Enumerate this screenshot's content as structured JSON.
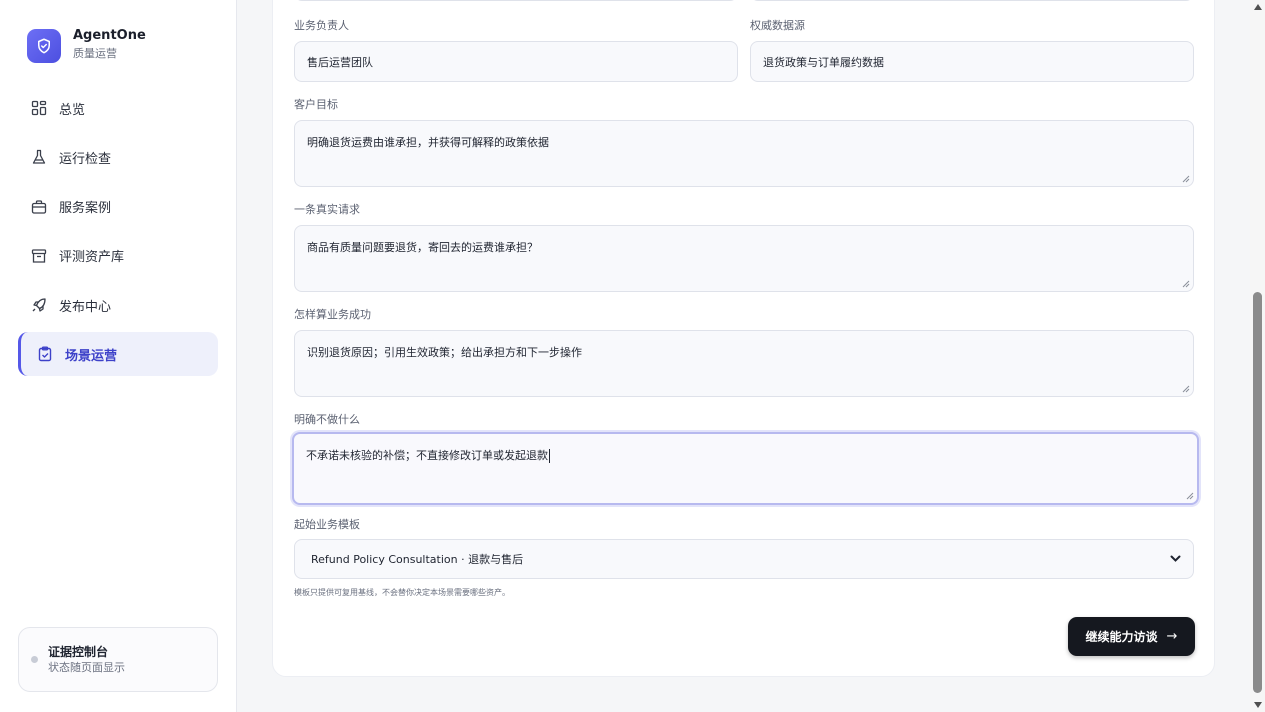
{
  "brand": {
    "name": "AgentOne",
    "subtitle": "质量运营"
  },
  "sidebar": {
    "items": [
      {
        "label": "总览",
        "icon": "grid-icon"
      },
      {
        "label": "运行检查",
        "icon": "flask-icon"
      },
      {
        "label": "服务案例",
        "icon": "briefcase-icon"
      },
      {
        "label": "评测资产库",
        "icon": "archive-icon"
      },
      {
        "label": "发布中心",
        "icon": "rocket-icon"
      },
      {
        "label": "场景运营",
        "icon": "clipboard-check-icon",
        "active": true
      }
    ]
  },
  "console": {
    "title": "证据控制台",
    "subtitle": "状态随页面显示"
  },
  "form": {
    "owner": {
      "label": "业务负责人",
      "value": "售后运营团队"
    },
    "source": {
      "label": "权威数据源",
      "value": "退货政策与订单履约数据"
    },
    "goal": {
      "label": "客户目标",
      "value": "明确退货运费由谁承担，并获得可解释的政策依据"
    },
    "request": {
      "label": "一条真实请求",
      "value": "商品有质量问题要退货，寄回去的运费谁承担？"
    },
    "success": {
      "label": "怎样算业务成功",
      "value": "识别退货原因；引用生效政策；给出承担方和下一步操作"
    },
    "not_do": {
      "label": "明确不做什么",
      "value": "不承诺未核验的补偿；不直接修改订单或发起退款"
    },
    "template": {
      "label": "起始业务模板",
      "value": "Refund Policy Consultation · 退款与售后",
      "hint": "模板只提供可复用基线，不会替你决定本场景需要哪些资产。"
    },
    "continue_label": "继续能力访谈",
    "continue_arrow": "→"
  },
  "colors": {
    "accent": "#5558e8",
    "button": "#15181f"
  }
}
